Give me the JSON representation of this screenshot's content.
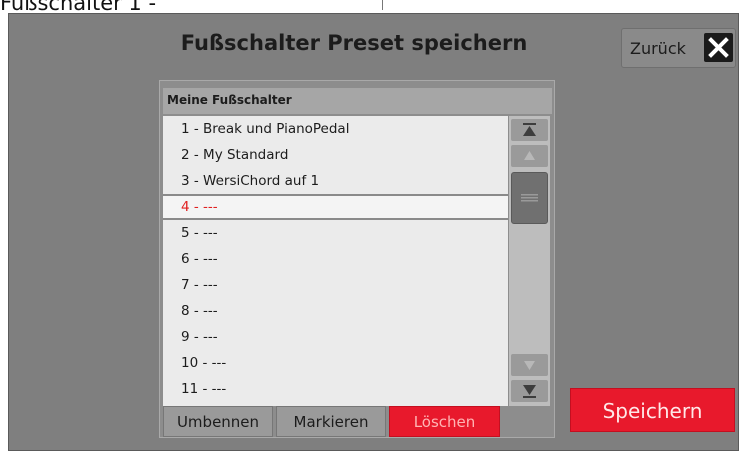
{
  "caption": "Fußschalter 1 -",
  "dialog": {
    "title": "Fußschalter Preset speichern",
    "back_label": "Zurück",
    "close_icon": "close-icon"
  },
  "list": {
    "header": "Meine Fußschalter",
    "items": [
      {
        "label": "1 - Break und PianoPedal",
        "selected": false
      },
      {
        "label": "2 - My Standard",
        "selected": false
      },
      {
        "label": "3 - WersiChord auf 1",
        "selected": false
      },
      {
        "label": "4 - ---",
        "selected": true
      },
      {
        "label": "5 - ---",
        "selected": false
      },
      {
        "label": "6 - ---",
        "selected": false
      },
      {
        "label": "7 - ---",
        "selected": false
      },
      {
        "label": "8 - ---",
        "selected": false
      },
      {
        "label": "9 - ---",
        "selected": false
      },
      {
        "label": "10 - ---",
        "selected": false
      },
      {
        "label": "11 - ---",
        "selected": false
      }
    ],
    "scroll_icons": [
      "scroll-top-icon",
      "scroll-up-icon",
      "scroll-down-icon",
      "scroll-bottom-icon"
    ]
  },
  "actions": {
    "rename": "Umbennen",
    "mark": "Markieren",
    "delete": "Löschen"
  },
  "save_label": "Speichern",
  "colors": {
    "accent_red": "#e8192c",
    "selected_text": "#e02020",
    "panel_gray": "#7f7f7f"
  }
}
